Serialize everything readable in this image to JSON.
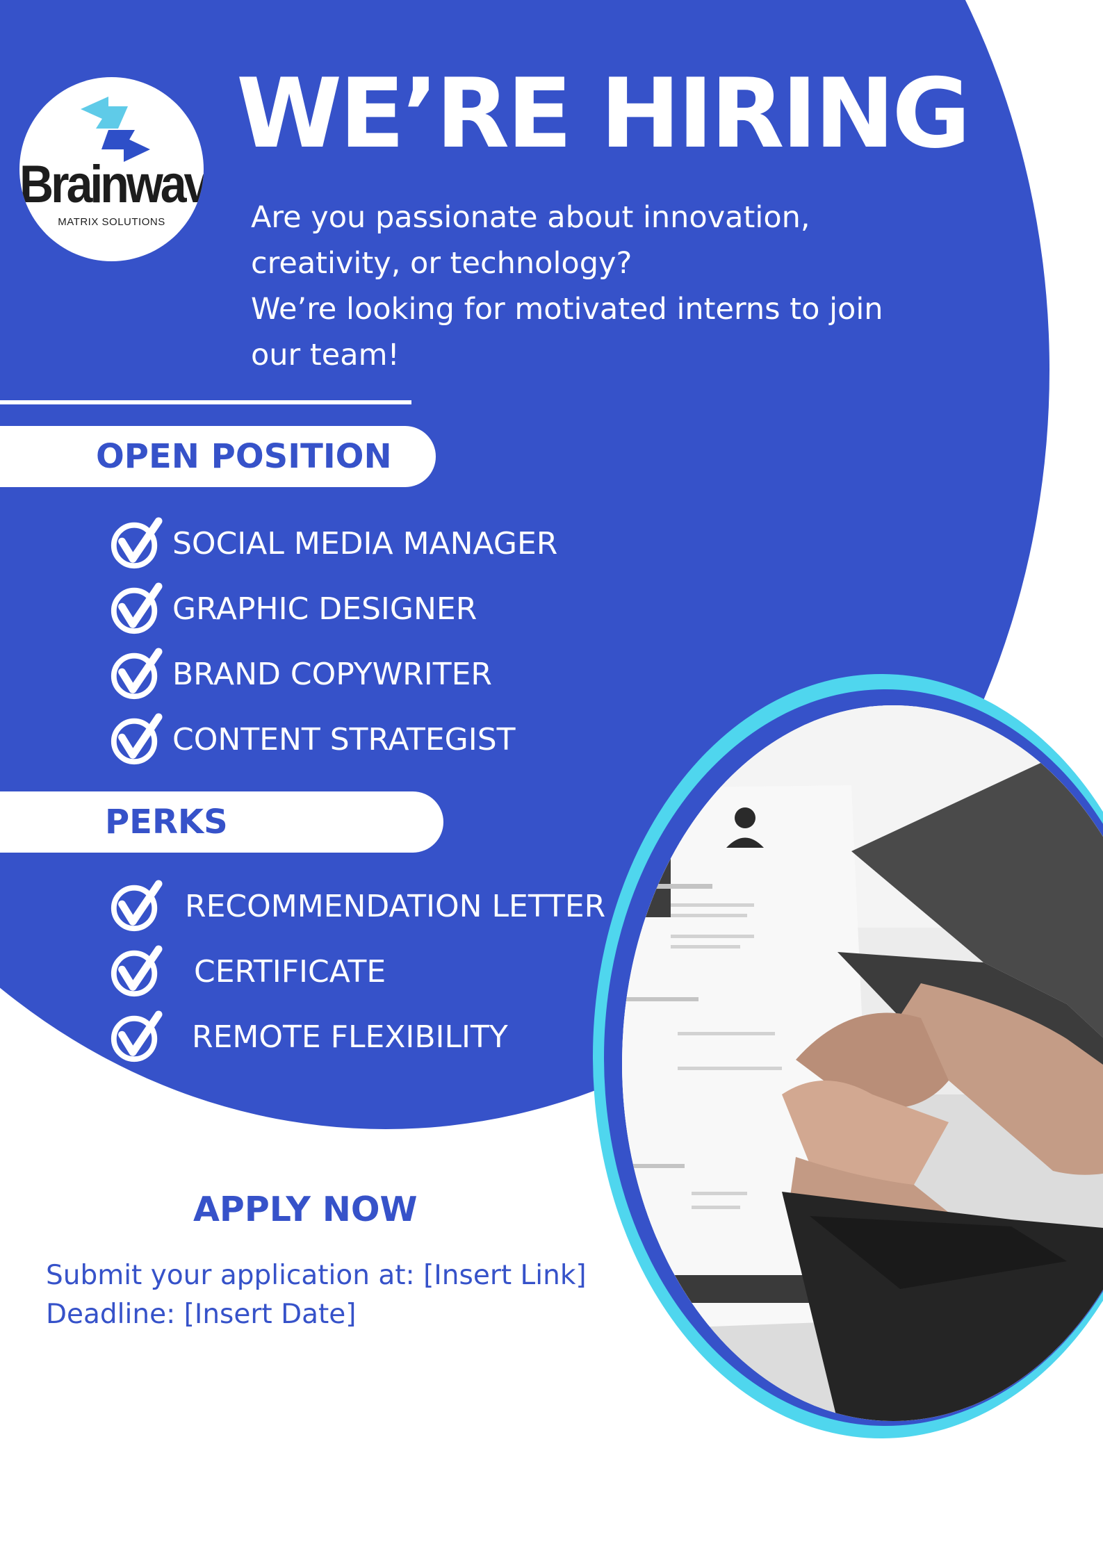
{
  "brand": {
    "logo_name": "Brainwave",
    "logo_tagline": "MATRIX SOLUTIONS",
    "logo_icon": "swap-arrows-icon"
  },
  "header": {
    "title": "WE’RE HIRING",
    "intro_lines": [
      "Are you passionate about innovation,",
      "creativity, or technology?",
      "We’re looking for motivated interns to join",
      "our team!"
    ]
  },
  "open_position": {
    "heading": "OPEN POSITION",
    "items": [
      "SOCIAL MEDIA MANAGER",
      "GRAPHIC DESIGNER",
      "BRAND COPYWRITER",
      "CONTENT STRATEGIST"
    ]
  },
  "perks": {
    "heading": "PERKS",
    "items": [
      "RECOMMENDATION LETTER",
      "CERTIFICATE",
      "REMOTE FLEXIBILITY"
    ]
  },
  "apply": {
    "heading": "APPLY NOW",
    "submit_line": "Submit your application at: [Insert Link]",
    "deadline_line": "Deadline: [Insert Date]"
  },
  "colors": {
    "primary": "#3652c9",
    "accent": "#4fd6ee",
    "text_on_primary": "#ffffff",
    "background": "#ffffff"
  },
  "icons": {
    "bullet": "check-circle-icon"
  }
}
